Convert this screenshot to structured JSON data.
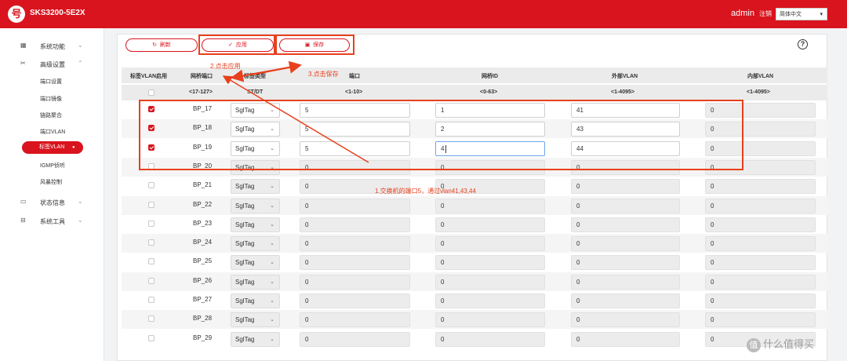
{
  "header": {
    "logo_char": "号",
    "model": "SKS3200-5E2X",
    "user": "admin",
    "logout": "注销",
    "language": "简体中文"
  },
  "sidebar": {
    "groups": [
      {
        "label": "系统功能",
        "icon": "grid-icon"
      },
      {
        "label": "高级设置",
        "icon": "tools-icon"
      },
      {
        "label": "状态信息",
        "icon": "monitor-icon"
      },
      {
        "label": "系统工具",
        "icon": "toolbox-icon"
      }
    ],
    "subitems": [
      "端口设置",
      "端口镜像",
      "链路聚合",
      "端口VLAN",
      "标签VLAN",
      "IGMP侦听",
      "风暴控制"
    ],
    "active": "标签VLAN"
  },
  "toolbar": {
    "refresh": "刷新",
    "apply": "应用",
    "save": "保存",
    "help": "?"
  },
  "table": {
    "headers": {
      "enable": "标签VLAN启用",
      "bridge_port": "网桥端口",
      "tag_type": "标签类型",
      "port": "端口",
      "bridge_id": "网桥ID",
      "ext_vlan": "外部VLAN",
      "int_vlan": "内部VLAN"
    },
    "ranges": {
      "bridge_port": "<17-127>",
      "tag_type": "ST/DT",
      "port": "<1-10>",
      "bridge_id": "<0-63>",
      "ext_vlan": "<1-4095>",
      "int_vlan": "<1-4095>"
    },
    "rows": [
      {
        "checked": true,
        "port": "BP_17",
        "type": "SglTag",
        "tag_port": "5",
        "bridge_id": "1",
        "ext_vlan": "41",
        "int_vlan": "0"
      },
      {
        "checked": true,
        "port": "BP_18",
        "type": "SglTag",
        "tag_port": "5",
        "bridge_id": "2",
        "ext_vlan": "43",
        "int_vlan": "0"
      },
      {
        "checked": true,
        "port": "BP_19",
        "type": "SglTag",
        "tag_port": "5",
        "bridge_id": "4",
        "ext_vlan": "44",
        "int_vlan": "0"
      },
      {
        "checked": false,
        "port": "BP_20",
        "type": "SglTag",
        "tag_port": "0",
        "bridge_id": "0",
        "ext_vlan": "0",
        "int_vlan": "0"
      },
      {
        "checked": false,
        "port": "BP_21",
        "type": "SglTag",
        "tag_port": "0",
        "bridge_id": "0",
        "ext_vlan": "0",
        "int_vlan": "0"
      },
      {
        "checked": false,
        "port": "BP_22",
        "type": "SglTag",
        "tag_port": "0",
        "bridge_id": "0",
        "ext_vlan": "0",
        "int_vlan": "0"
      },
      {
        "checked": false,
        "port": "BP_23",
        "type": "SglTag",
        "tag_port": "0",
        "bridge_id": "0",
        "ext_vlan": "0",
        "int_vlan": "0"
      },
      {
        "checked": false,
        "port": "BP_24",
        "type": "SglTag",
        "tag_port": "0",
        "bridge_id": "0",
        "ext_vlan": "0",
        "int_vlan": "0"
      },
      {
        "checked": false,
        "port": "BP_25",
        "type": "SglTag",
        "tag_port": "0",
        "bridge_id": "0",
        "ext_vlan": "0",
        "int_vlan": "0"
      },
      {
        "checked": false,
        "port": "BP_26",
        "type": "SglTag",
        "tag_port": "0",
        "bridge_id": "0",
        "ext_vlan": "0",
        "int_vlan": "0"
      },
      {
        "checked": false,
        "port": "BP_27",
        "type": "SglTag",
        "tag_port": "0",
        "bridge_id": "0",
        "ext_vlan": "0",
        "int_vlan": "0"
      },
      {
        "checked": false,
        "port": "BP_28",
        "type": "SglTag",
        "tag_port": "0",
        "bridge_id": "0",
        "ext_vlan": "0",
        "int_vlan": "0"
      },
      {
        "checked": false,
        "port": "BP_29",
        "type": "SglTag",
        "tag_port": "0",
        "bridge_id": "0",
        "ext_vlan": "0",
        "int_vlan": "0"
      }
    ]
  },
  "annotations": {
    "step1": "1.交换机的端口5，通过vlan41,43,44",
    "step2": "2.点击应用",
    "step3": "3.点击保存",
    "color": "#e8401c"
  },
  "watermark": {
    "icon_char": "值",
    "text": "什么值得买"
  },
  "colors": {
    "brand": "#d9141e",
    "annotation": "#e8401c"
  }
}
